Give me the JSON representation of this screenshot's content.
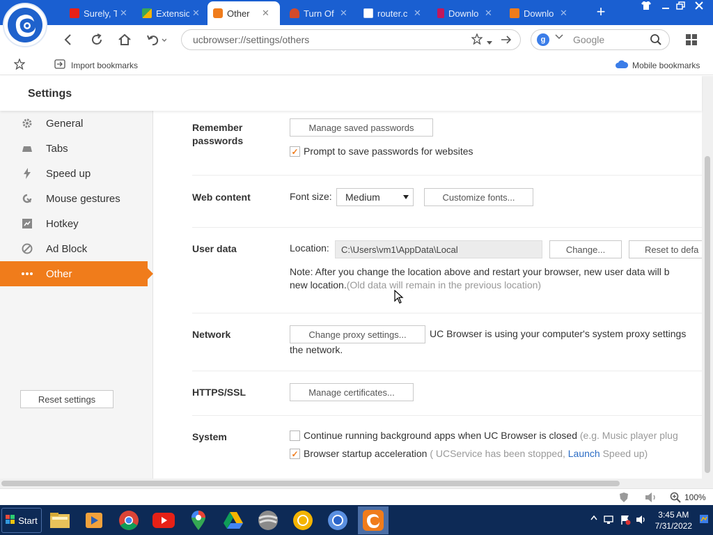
{
  "browser": {
    "tabs": [
      {
        "label": "Surely, T",
        "icon": "youtube-icon",
        "color": "#e62117"
      },
      {
        "label": "Extensio",
        "icon": "extensions-icon",
        "color": "#3aa757"
      },
      {
        "label": "Other",
        "icon": "gear-icon",
        "color": "#f07c1b"
      },
      {
        "label": "Turn Of",
        "icon": "page-icon",
        "color": "#d34b2b"
      },
      {
        "label": "router.c",
        "icon": "document-icon",
        "color": "#ffffff"
      },
      {
        "label": "Downlo",
        "icon": "download-page-icon",
        "color": "#c2185b"
      },
      {
        "label": "Downlo",
        "icon": "download-icon",
        "color": "#f07c1b"
      }
    ],
    "close_glyph": "✕",
    "new_tab_glyph": "+",
    "url": "ucbrowser://settings/others",
    "search_engine_letter": "g",
    "search_placeholder": "Google",
    "bookmarks": {
      "import_label": "Import bookmarks",
      "mobile_label": "Mobile bookmarks"
    }
  },
  "settings": {
    "title": "Settings",
    "sidebar": {
      "items": [
        {
          "label": "General",
          "icon": "gear-icon"
        },
        {
          "label": "Tabs",
          "icon": "tabs-icon"
        },
        {
          "label": "Speed up",
          "icon": "lightning-icon"
        },
        {
          "label": "Mouse gestures",
          "icon": "gesture-icon"
        },
        {
          "label": "Hotkey",
          "icon": "hotkey-icon"
        },
        {
          "label": "Ad Block",
          "icon": "block-icon"
        },
        {
          "label": "Other",
          "icon": "more-icon",
          "active": true
        }
      ],
      "reset_label": "Reset settings"
    },
    "passwords": {
      "label": "Remember passwords",
      "manage_button": "Manage saved passwords",
      "prompt_checkbox": "Prompt to save passwords for websites",
      "prompt_checked": true
    },
    "web_content": {
      "label": "Web content",
      "font_size_label": "Font size:",
      "font_size_value": "Medium",
      "customize_button": "Customize fonts..."
    },
    "user_data": {
      "label": "User data",
      "location_label": "Location:",
      "location_value": "C:\\Users\\vm1\\AppData\\Local",
      "change_button": "Change...",
      "reset_button": "Reset to defa",
      "note": "Note: After you change the location above and restart your browser, new user data will b",
      "note_line2": "new location.",
      "note_gray": "(Old data will remain in the previous location)"
    },
    "network": {
      "label": "Network",
      "proxy_button": "Change proxy settings...",
      "proxy_text": "UC Browser is using your computer's system proxy settings",
      "proxy_text2": "the network."
    },
    "https": {
      "label": "HTTPS/SSL",
      "cert_button": "Manage certificates..."
    },
    "system": {
      "label": "System",
      "bg_checkbox": "Continue running background apps when UC Browser is closed",
      "bg_hint": "(e.g. Music player plug",
      "bg_checked": false,
      "accel_checkbox": "Browser startup acceleration",
      "accel_hint_pre": "( UCService has been stopped,",
      "accel_link": "Launch",
      "accel_hint_post": "Speed up)",
      "accel_checked": true
    }
  },
  "statusbar": {
    "zoom": "100%"
  },
  "taskbar": {
    "start_label": "Start",
    "apps": [
      "file-explorer-icon",
      "media-player-icon",
      "chrome-icon",
      "youtube-icon",
      "maps-icon",
      "drive-icon",
      "pro-icon",
      "chrome-canary-icon",
      "chromium-icon",
      "uc-browser-icon"
    ],
    "time": "3:45 AM",
    "date": "7/31/2022"
  },
  "colors": {
    "accent": "#f07c1b",
    "titlebar": "#1a5fd1",
    "taskbar": "#0d2a56",
    "link": "#2b6cc4"
  }
}
